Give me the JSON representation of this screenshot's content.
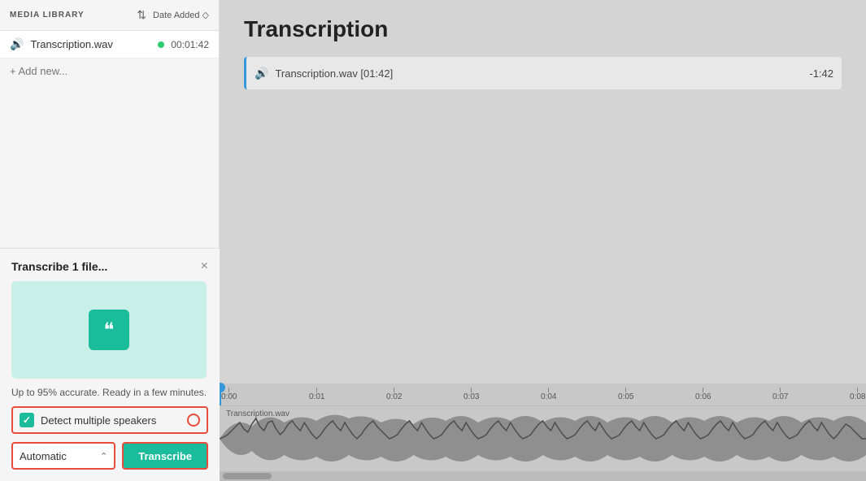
{
  "sidebar": {
    "header_title": "MEDIA LIBRARY",
    "sort_icon": "⇅",
    "date_added_label": "Date Added",
    "date_added_arrow": "◇",
    "media_items": [
      {
        "name": "Transcription.wav",
        "duration": "00:01:42",
        "has_dot": true
      }
    ],
    "add_new_label": "+ Add new..."
  },
  "transcribe_panel": {
    "title": "Transcribe 1 file...",
    "close_icon": "×",
    "accuracy_text": "Up to 95% accurate. Ready in a few minutes.",
    "detect_speakers_label": "Detect multiple speakers",
    "automatic_label": "Automatic",
    "transcribe_button": "Transcribe",
    "quote_char": "❝"
  },
  "main": {
    "title": "Transcription",
    "audio_track": {
      "name": "Transcription.wav [01:42]",
      "time_remaining": "-1:42"
    }
  },
  "timeline": {
    "markers": [
      "0:00",
      "0:01",
      "0:02",
      "0:03",
      "0:04",
      "0:05",
      "0:06",
      "0:07",
      "0:08"
    ],
    "waveform_label": "Transcription.wav"
  }
}
